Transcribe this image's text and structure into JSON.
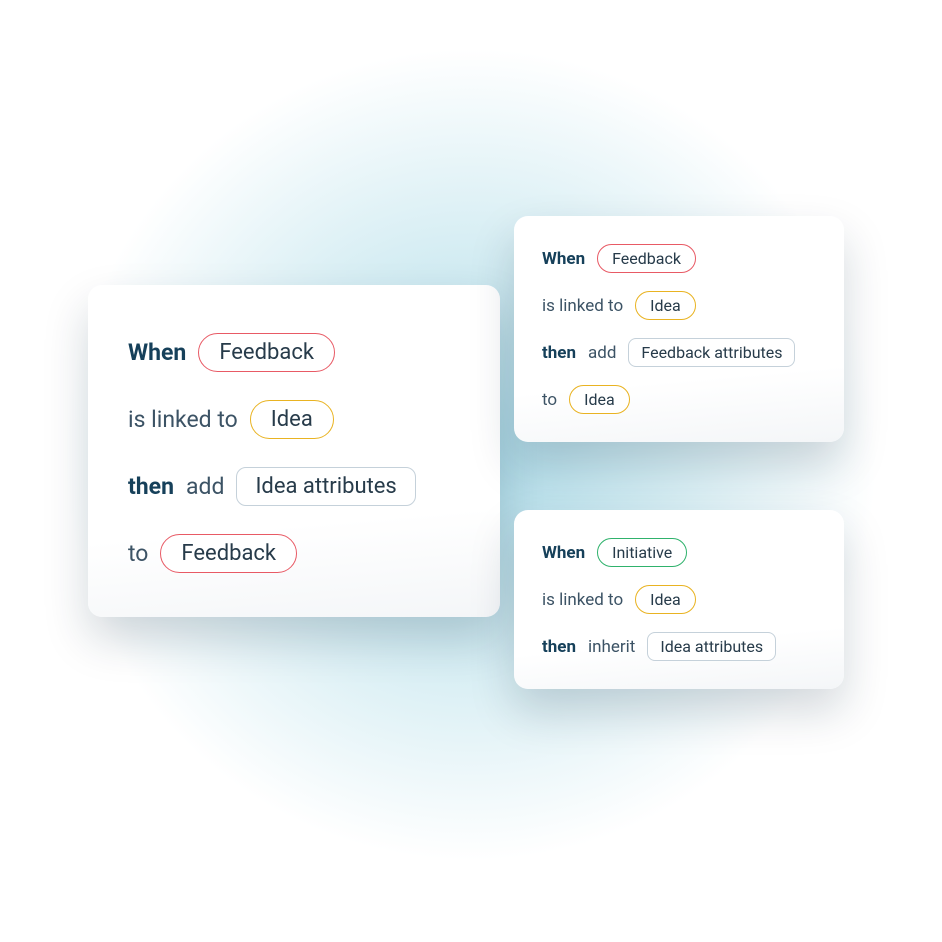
{
  "cards": {
    "main": {
      "rows": [
        {
          "keyword": "When",
          "tag": {
            "text": "Feedback",
            "color": "red"
          }
        },
        {
          "plain_before": "is linked to",
          "tag": {
            "text": "Idea",
            "color": "yellow"
          }
        },
        {
          "keyword": "then",
          "plain_after_kw": "add",
          "tag": {
            "text": "Idea attributes",
            "color": "gray"
          }
        },
        {
          "plain_before": "to",
          "tag": {
            "text": "Feedback",
            "color": "red"
          }
        }
      ]
    },
    "top_right": {
      "rows": [
        {
          "keyword": "When",
          "tag": {
            "text": "Feedback",
            "color": "red"
          }
        },
        {
          "plain_before": "is linked to",
          "tag": {
            "text": "Idea",
            "color": "yellow"
          }
        },
        {
          "keyword": "then",
          "plain_after_kw": "add",
          "tag": {
            "text": "Feedback attributes",
            "color": "gray"
          }
        },
        {
          "plain_before": "to",
          "tag": {
            "text": "Idea",
            "color": "yellow"
          }
        }
      ]
    },
    "bottom_right": {
      "rows": [
        {
          "keyword": "When",
          "tag": {
            "text": "Initiative",
            "color": "green"
          }
        },
        {
          "plain_before": "is linked to",
          "tag": {
            "text": "Idea",
            "color": "yellow"
          }
        },
        {
          "keyword": "then",
          "plain_after_kw": "inherit",
          "tag": {
            "text": "Idea attributes",
            "color": "gray"
          }
        }
      ]
    }
  }
}
